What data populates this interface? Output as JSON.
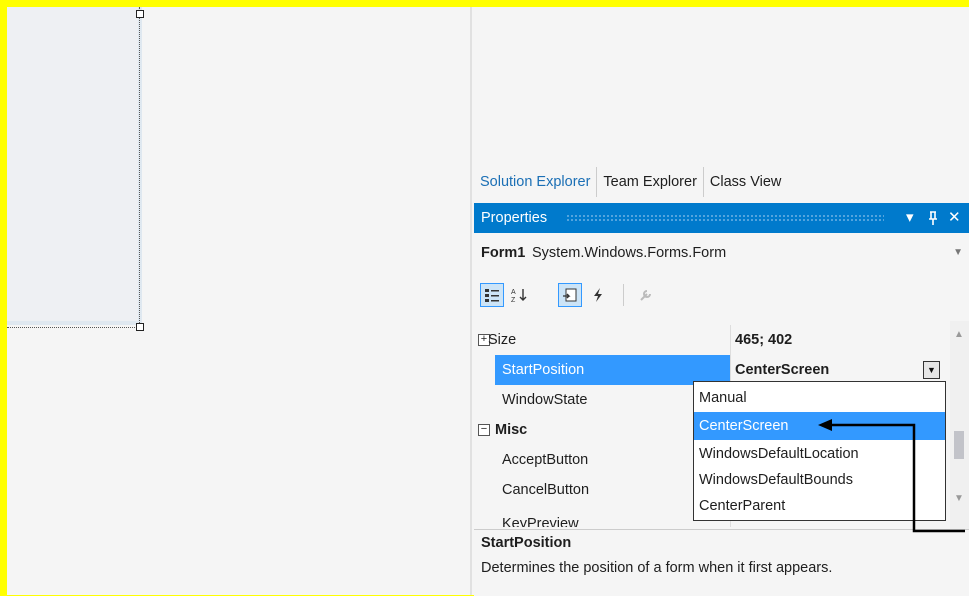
{
  "tabs": [
    "Solution Explorer",
    "Team Explorer",
    "Class View"
  ],
  "properties_panel": {
    "title": "Properties",
    "title_buttons": {
      "dropdown": "▾",
      "pin": "ᵽ",
      "close": "✕"
    },
    "object_name": "Form1",
    "object_type": "System.Windows.Forms.Form",
    "toolbar_icons": [
      "categorized-icon",
      "alphabetical-icon",
      "properties-icon",
      "events-icon",
      "property-pages-icon"
    ]
  },
  "grid": {
    "rows": [
      {
        "name": "Size",
        "value": "465; 402",
        "expander": "+"
      },
      {
        "name": "StartPosition",
        "value": "CenterScreen",
        "selected": true
      },
      {
        "name": "WindowState",
        "value": ""
      },
      {
        "name": "Misc",
        "value": "",
        "expander": "−",
        "category": true
      },
      {
        "name": "AcceptButton",
        "value": ""
      },
      {
        "name": "CancelButton",
        "value": ""
      },
      {
        "name": "KeyPreview",
        "value": ""
      }
    ]
  },
  "dropdown": {
    "options": [
      "Manual",
      "CenterScreen",
      "WindowsDefaultLocation",
      "WindowsDefaultBounds",
      "CenterParent"
    ],
    "highlighted": "CenterScreen"
  },
  "description": {
    "title": "StartPosition",
    "text": "Determines the position of a form when it first appears."
  },
  "colors": {
    "frame": "#ffff00",
    "accent": "#007acc",
    "selection": "#3399ff"
  }
}
